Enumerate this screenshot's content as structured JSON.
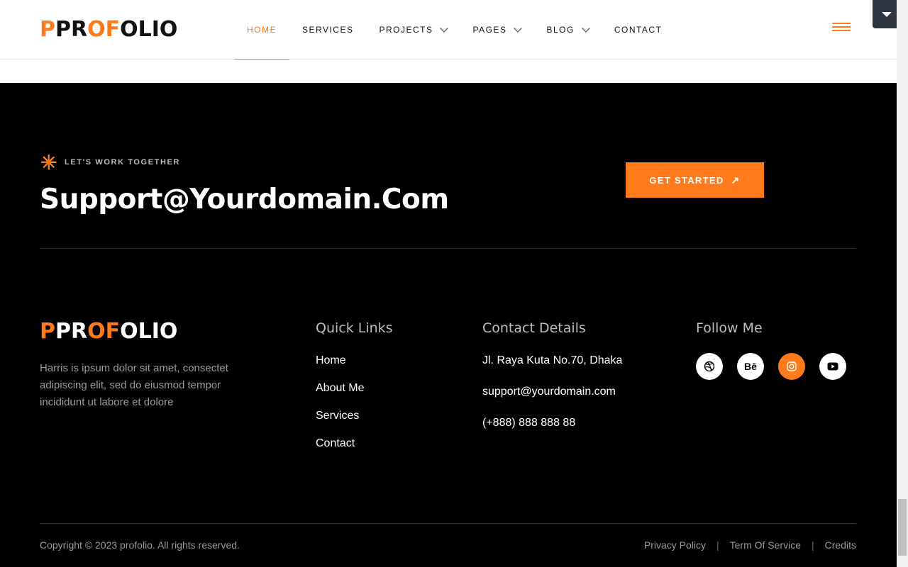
{
  "header": {
    "logo": {
      "p1": "PR",
      "o1": "O",
      "p2": "",
      "o2": "F",
      "p3": "OLIO",
      "first": "P"
    },
    "nav": [
      {
        "label": "HOME",
        "active": true,
        "dropdown": false
      },
      {
        "label": "SERVICES",
        "active": false,
        "dropdown": false
      },
      {
        "label": "PROJECTS",
        "active": false,
        "dropdown": true
      },
      {
        "label": "PAGES",
        "active": false,
        "dropdown": true
      },
      {
        "label": "BLOG",
        "active": false,
        "dropdown": true
      },
      {
        "label": "CONTACT",
        "active": false,
        "dropdown": false
      }
    ]
  },
  "cta_section": {
    "eyebrow": "LET'S WORK TOGETHER",
    "email": "Support@Yourdomain.Com",
    "button_label": "GET STARTED",
    "arrow": "↗"
  },
  "footer": {
    "about": "Harris is ipsum dolor sit amet, consectet adipiscing elit, sed do eiusmod tempor incididunt ut labore et dolore",
    "quick_links_title": "Quick Links",
    "quick_links": [
      "Home",
      "About Me",
      "Services",
      "Contact"
    ],
    "contact_title": "Contact Details",
    "contact": [
      "Jl. Raya Kuta No.70, Dhaka",
      "support@yourdomain.com",
      "(+888) 888 888 88"
    ],
    "follow_title": "Follow Me",
    "socials": [
      {
        "icon": "dribbble-icon",
        "glyph": "",
        "active": false
      },
      {
        "icon": "behance-icon",
        "glyph": "Bē",
        "active": false
      },
      {
        "icon": "instagram-icon",
        "glyph": "",
        "active": true
      },
      {
        "icon": "youtube-icon",
        "glyph": "",
        "active": false
      }
    ],
    "copyright": "Copyright © 2023 profolio. All rights reserved.",
    "legal": [
      "Privacy Policy",
      "Term Of Service",
      "Credits"
    ],
    "separator": "|"
  },
  "colors": {
    "accent": "#ff7a1a",
    "footer_bg": "#000000"
  }
}
